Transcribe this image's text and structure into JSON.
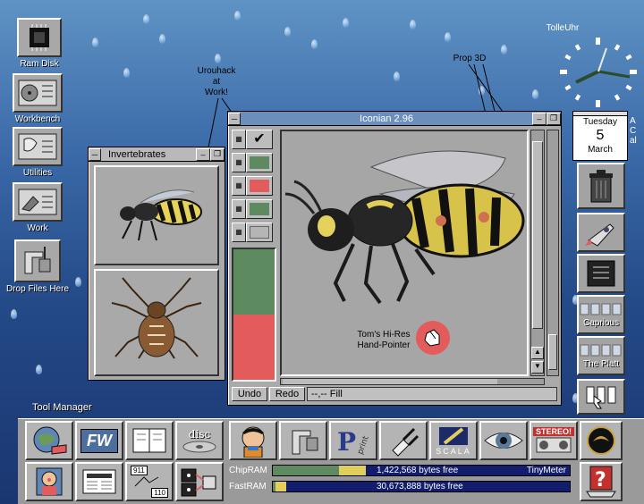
{
  "desktop": {
    "icons": [
      {
        "label": "Ram Disk"
      },
      {
        "label": "Workbench"
      },
      {
        "label": "Utilities"
      },
      {
        "label": "Work"
      },
      {
        "label": "Drop Files Here"
      }
    ],
    "tool_manager_label": "Tool Manager"
  },
  "clock": {
    "label": "TolleUhr"
  },
  "calendar": {
    "day": "Tuesday",
    "date": "5",
    "month": "March",
    "side_text": "ACal"
  },
  "annotations": {
    "urouhack": "Urouhack\nat\nWork!",
    "prop3d": "Prop 3D",
    "pointer": "Tom's Hi-Res\nHand-Pointer"
  },
  "invertebrates_window": {
    "title": "Invertebrates"
  },
  "iconian_window": {
    "title": "Iconian 2.96",
    "undo_label": "Undo",
    "redo_label": "Redo",
    "status": "--,-- Fill",
    "colors": {
      "swatch_green": "#5d8a5f",
      "swatch_red": "#e35b5b"
    }
  },
  "right_panel": {
    "caprious_label": "Caprious",
    "platt_label": "The Platt"
  },
  "dock": {
    "chip_label": "ChipRAM",
    "chip_value": "1,422,568 bytes free",
    "chip_used_fraction": 0.7,
    "fast_label": "FastRAM",
    "fast_value": "30,673,888 bytes free",
    "fast_used_fraction": 0.08,
    "meter_title": "TinyMeter",
    "fw_label": "FW",
    "disc_label": "disc",
    "scala_label": "SCALA",
    "stereo_label": "STEREO!",
    "counters": {
      "top": "911",
      "bottom": "110"
    }
  }
}
